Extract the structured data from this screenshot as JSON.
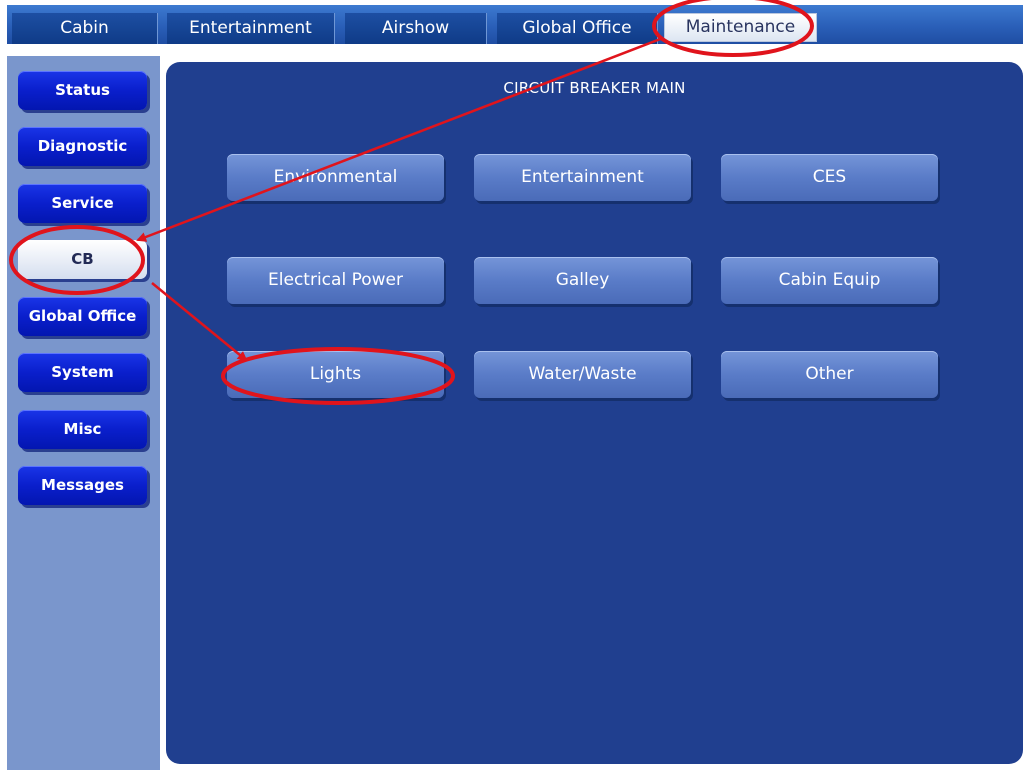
{
  "tabs": [
    {
      "label": "Cabin",
      "active": false
    },
    {
      "label": "Entertainment",
      "active": false
    },
    {
      "label": "Airshow",
      "active": false
    },
    {
      "label": "Global Office",
      "active": false
    },
    {
      "label": "Maintenance",
      "active": true
    }
  ],
  "sidebar": {
    "items": [
      {
        "label": "Status",
        "active": false
      },
      {
        "label": "Diagnostic",
        "active": false
      },
      {
        "label": "Service",
        "active": false
      },
      {
        "label": "CB",
        "active": true
      },
      {
        "label": "Global Office",
        "active": false
      },
      {
        "label": "System",
        "active": false
      },
      {
        "label": "Misc",
        "active": false
      },
      {
        "label": "Messages",
        "active": false
      }
    ]
  },
  "main": {
    "title": "CIRCUIT BREAKER MAIN",
    "buttons": [
      {
        "label": "Environmental"
      },
      {
        "label": "Entertainment"
      },
      {
        "label": "CES"
      },
      {
        "label": "Electrical Power"
      },
      {
        "label": "Galley"
      },
      {
        "label": "Cabin Equip"
      },
      {
        "label": "Lights"
      },
      {
        "label": "Water/Waste"
      },
      {
        "label": "Other"
      }
    ]
  },
  "annotations": {
    "color": "#e0141c",
    "highlighted": [
      "Maintenance",
      "CB",
      "Lights"
    ]
  },
  "colors": {
    "tabbar": "#2a5fb8",
    "sidebar_bg": "#7a96cc",
    "main_bg": "#203f8f",
    "nav_button": "#0a1fcc",
    "cb_button": "#5a7cc8"
  }
}
